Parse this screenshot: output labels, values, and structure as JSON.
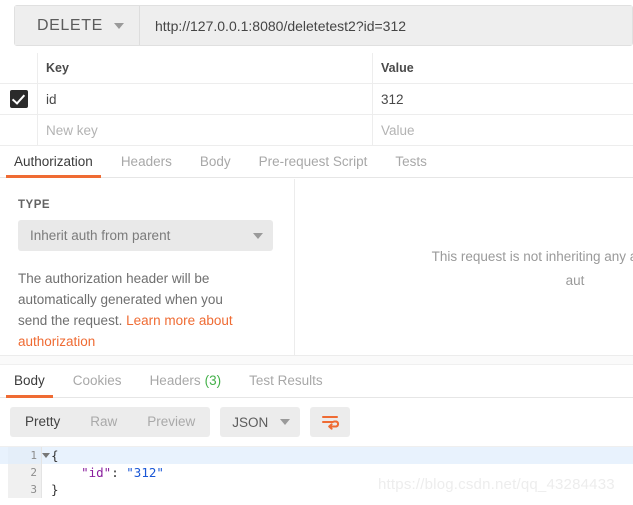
{
  "request": {
    "method": "DELETE",
    "url": "http://127.0.0.1:8080/deletetest2?id=312"
  },
  "params_table": {
    "headers": {
      "key": "Key",
      "value": "Value"
    },
    "rows": [
      {
        "checked": true,
        "key": "id",
        "value": "312"
      }
    ],
    "new_row": {
      "key_placeholder": "New key",
      "value_placeholder": "Value"
    }
  },
  "request_tabs": [
    {
      "label": "Authorization",
      "active": true
    },
    {
      "label": "Headers",
      "active": false
    },
    {
      "label": "Body",
      "active": false
    },
    {
      "label": "Pre-request Script",
      "active": false
    },
    {
      "label": "Tests",
      "active": false
    }
  ],
  "auth": {
    "type_label": "TYPE",
    "type_value": "Inherit auth from parent",
    "description_text": "The authorization header will be automatically generated when you send the request. ",
    "description_link": "Learn more about authorization",
    "inherit_notice_line1": "This request is not inheriting any authorization h",
    "inherit_notice_line2": "aut"
  },
  "response_tabs": [
    {
      "label": "Body",
      "count": "",
      "active": true
    },
    {
      "label": "Cookies",
      "count": "",
      "active": false
    },
    {
      "label": "Headers",
      "count": "(3)",
      "active": false
    },
    {
      "label": "Test Results",
      "count": "",
      "active": false
    }
  ],
  "body_toolbar": {
    "views": [
      {
        "label": "Pretty",
        "active": true
      },
      {
        "label": "Raw",
        "active": false
      },
      {
        "label": "Preview",
        "active": false
      }
    ],
    "format": "JSON",
    "wrap_icon": "word-wrap-icon"
  },
  "response_body": {
    "lines": [
      {
        "num": "1",
        "text": "{",
        "foldable": true,
        "highlight": true
      },
      {
        "num": "2",
        "text": "    \"id\": \"312\"",
        "foldable": false,
        "highlight": false,
        "key": "\"id\"",
        "sep": ": ",
        "val": "\"312\"",
        "indent": "    "
      },
      {
        "num": "3",
        "text": "}",
        "foldable": false,
        "highlight": false
      }
    ]
  },
  "watermark": "https://blog.csdn.net/qq_43284433",
  "colors": {
    "accent": "#ef6b33",
    "count_green": "#44b14a",
    "json_key": "#8a1f9e",
    "json_string": "#1a57d6",
    "checkbox": "#2b2b2b"
  }
}
